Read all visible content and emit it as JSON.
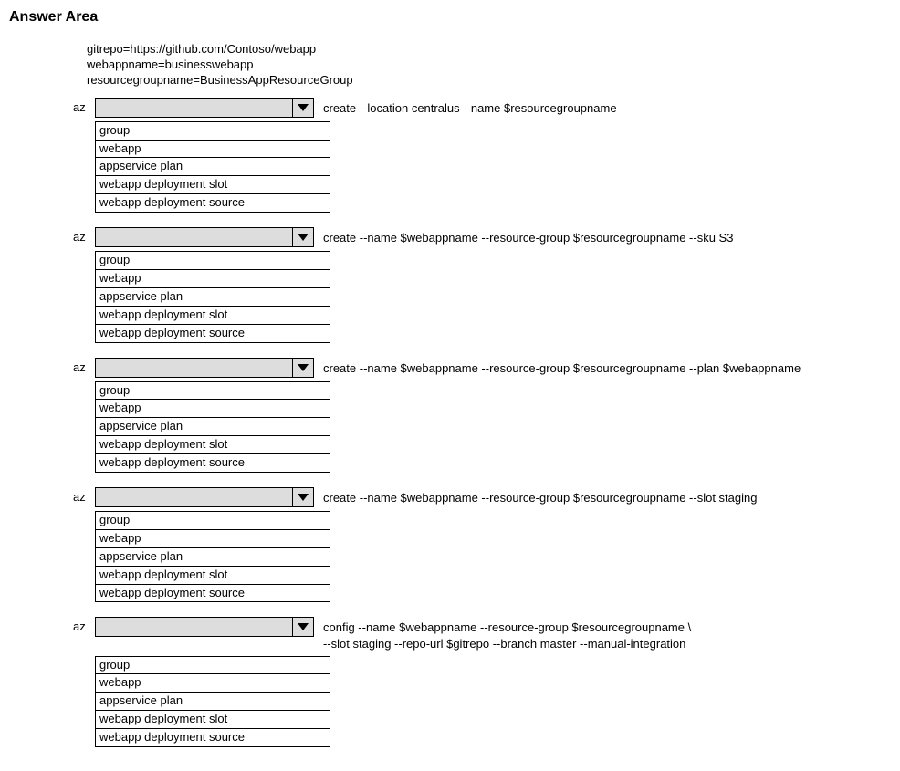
{
  "title": "Answer Area",
  "vars": {
    "line1": "gitrepo=https://github.com/Contoso/webapp",
    "line2": "webappname=businesswebapp",
    "line3": "resourcegroupname=BusinessAppResourceGroup"
  },
  "azLabel": "az",
  "options": [
    "group",
    "webapp",
    "appservice plan",
    "webapp deployment slot",
    "webapp deployment source"
  ],
  "commands": {
    "cmd1": "create --location centralus --name $resourcegroupname",
    "cmd2": "create --name $webappname --resource-group $resourcegroupname --sku S3",
    "cmd3": "create --name $webappname --resource-group $resourcegroupname --plan $webappname",
    "cmd4": "create --name $webappname --resource-group $resourcegroupname --slot staging",
    "cmd5a": "config --name $webappname --resource-group $resourcegroupname \\",
    "cmd5b": "--slot staging --repo-url $gitrepo --branch master --manual-integration"
  }
}
